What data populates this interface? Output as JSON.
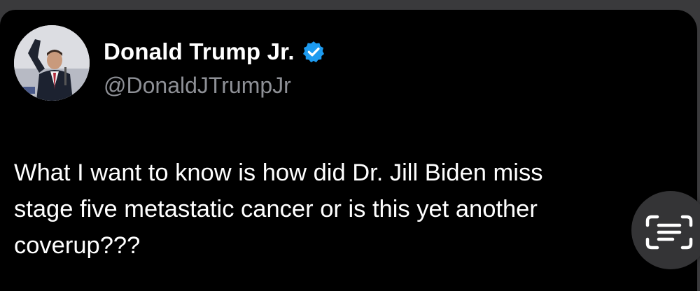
{
  "tweet": {
    "author": {
      "display_name": "Donald Trump Jr.",
      "handle": "@DonaldJTrumpJr",
      "verified": true,
      "avatar_icon": "profile-photo"
    },
    "text": "What I want to know is how did Dr. Jill Biden miss\nstage five metastatic cancer or is this yet another\ncoverup???"
  },
  "overlay": {
    "live_text_icon": "text-scan-icon"
  },
  "colors": {
    "background": "#000000",
    "text": "#ffffff",
    "handle": "#8e9096",
    "verified_badge": "#1d9bf0"
  }
}
